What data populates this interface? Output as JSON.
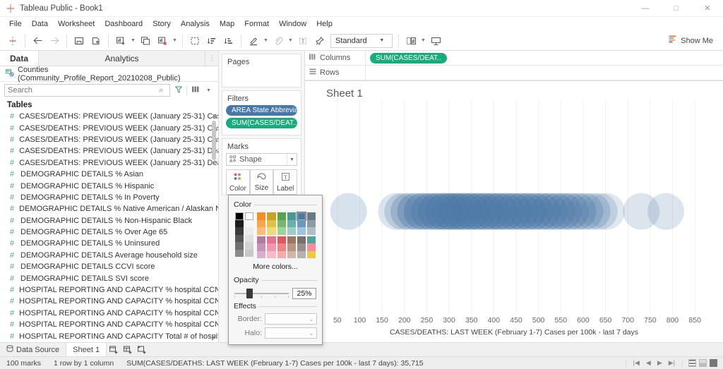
{
  "window": {
    "title": "Tableau Public - Book1",
    "logo_icon": "tableau-logo-icon",
    "minimize_label": "—",
    "maximize_label": "□",
    "close_label": "✕"
  },
  "menubar": {
    "items": [
      "File",
      "Data",
      "Worksheet",
      "Dashboard",
      "Story",
      "Analysis",
      "Map",
      "Format",
      "Window",
      "Help"
    ]
  },
  "toolbar": {
    "fit_value": "Standard",
    "show_me_label": "Show Me",
    "icons": [
      "tableau-home-icon",
      "back-arrow-icon",
      "forward-arrow-icon",
      "save-icon",
      "new-data-source-icon",
      "new-worksheet-icon",
      "duplicate-sheet-icon",
      "clear-sheet-icon",
      "clear-selection-icon",
      "sort-ascending-icon",
      "sort-descending-icon",
      "highlight-icon",
      "group-members-icon",
      "show-mark-labels-icon",
      "presentation-pin-icon",
      "fit-selector",
      "fix-axes-icon",
      "presentation-mode-icon"
    ]
  },
  "data_pane": {
    "tab_data": "Data",
    "tab_analytics": "Analytics",
    "datasource": "Counties (Community_Profile_Report_20210208_Public)",
    "datasource_icon": "data-source-icon",
    "search_placeholder": "Search",
    "search_value": "",
    "search_icon": "search-icon",
    "filter_icon": "funnel-icon",
    "group_icon": "grid-view-icon",
    "caret_icon": "chevron-down-icon",
    "tables_header": "Tables",
    "fields": [
      "CASES/DEATHS: PREVIOUS WEEK (January 25-31) Cases ...",
      "CASES/DEATHS: PREVIOUS WEEK (January 25-31) Cases ...",
      "CASES/DEATHS: PREVIOUS WEEK (January 25-31) Cases ...",
      "CASES/DEATHS: PREVIOUS WEEK (January 25-31) Deaths...",
      "CASES/DEATHS: PREVIOUS WEEK (January 25-31) Deaths...",
      "DEMOGRAPHIC DETAILS % Asian",
      "DEMOGRAPHIC DETAILS % Hispanic",
      "DEMOGRAPHIC DETAILS % In Poverty",
      "DEMOGRAPHIC DETAILS % Native American / Alaskan Nat...",
      "DEMOGRAPHIC DETAILS % Non-Hispanic Black",
      "DEMOGRAPHIC DETAILS % Over Age 65",
      "DEMOGRAPHIC DETAILS % Uninsured",
      "DEMOGRAPHIC DETAILS Average household size",
      "DEMOGRAPHIC DETAILS CCVI score",
      "DEMOGRAPHIC DETAILS SVI score",
      "HOSPITAL REPORTING AND CAPACITY % hospital CCNs e...",
      "HOSPITAL REPORTING AND CAPACITY % hospital CCNs r...",
      "HOSPITAL REPORTING AND CAPACITY % hospital CCNs r...",
      "HOSPITAL REPORTING AND CAPACITY % hospital CCNs r...",
      "HOSPITAL REPORTING AND CAPACITY Total # of hospital ..."
    ],
    "field_icon": "number-field-icon"
  },
  "shelf_column": {
    "pages_label": "Pages",
    "filters_label": "Filters",
    "filter_pills": [
      {
        "label": "AREA State Abbrevia..",
        "color": "#4878a8"
      },
      {
        "label": "SUM(CASES/DEAT..",
        "color": "#1aab7c"
      }
    ],
    "marks_label": "Marks",
    "marks_type": "Shape",
    "marks_type_icon": "shape-mark-icon",
    "buttons": [
      {
        "label": "Color",
        "icon": "color-palette-icon"
      },
      {
        "label": "Size",
        "icon": "size-icon"
      },
      {
        "label": "Label",
        "icon": "text-label-icon"
      }
    ]
  },
  "color_popup": {
    "color_label": "Color",
    "more_colors_label": "More colors...",
    "opacity_label": "Opacity",
    "opacity_value": "25%",
    "opacity_percent": 25,
    "effects_label": "Effects",
    "border_label": "Border:",
    "halo_label": "Halo:",
    "border_value": "",
    "halo_value": "",
    "swatch_columns": [
      [
        "#000000",
        "#1c1c1c",
        "#3a3a3a",
        "#555555",
        "#6f6f6f",
        "#8a8a8a"
      ],
      [
        "#ffffff",
        "#f4f4f4",
        "#e8e8e8",
        "#dddddd",
        "#d2d2d2",
        "#c6c6c6"
      ],
      [
        "#f28e2c",
        "#f5a64f",
        "#f8bd7d",
        "#b07aa1",
        "#c394b5",
        "#d7b0cb"
      ],
      [
        "#c8a02c",
        "#e0c14b",
        "#eedb7c",
        "#e15759",
        "#ef8384",
        "#f6abab"
      ],
      [
        "#59a14f",
        "#76b86c",
        "#9ed39a",
        "#e15759",
        "#ef8384",
        "#f6abab"
      ],
      [
        "#499894",
        "#6bb0ac",
        "#9ccfcb",
        "#9d7660",
        "#b99482",
        "#d2b5a6"
      ],
      [
        "#4e79a7",
        "#6f96bd",
        "#a0c4e0",
        "#79706e",
        "#958e8c",
        "#b6b0ae"
      ],
      [
        "#6b7b86",
        "#8c9aa4",
        "#b3bec6",
        "#4fa39a",
        "#f98b9e",
        "#edc948"
      ]
    ]
  },
  "view": {
    "columns_label": "Columns",
    "columns_icon": "columns-shelf-icon",
    "rows_label": "Rows",
    "rows_icon": "rows-shelf-icon",
    "columns_pill": "SUM(CASES/DEAT..",
    "sheet_title": "Sheet 1"
  },
  "chart_data": {
    "type": "scatter",
    "title": "Sheet 1",
    "xlabel": "CASES/DEATHS: LAST WEEK (February 1-7) Cases per 100k - last 7 days",
    "ylabel": "",
    "xticks": [
      50,
      100,
      150,
      200,
      250,
      300,
      350,
      400,
      450,
      500,
      550,
      600,
      650,
      700,
      750,
      800,
      850
    ],
    "xlim": [
      25,
      875
    ],
    "grid": true,
    "legend": null,
    "mark_shape": "circle",
    "mark_color": "#4e79a7",
    "mark_opacity": 0.25,
    "mark_count_label": "100 marks",
    "points": [
      {
        "x": 75,
        "r": 26,
        "a": 0.22
      },
      {
        "x": 182,
        "r": 26,
        "a": 0.2
      },
      {
        "x": 196,
        "r": 26,
        "a": 0.24
      },
      {
        "x": 210,
        "r": 26,
        "a": 0.3
      },
      {
        "x": 225,
        "r": 26,
        "a": 0.38
      },
      {
        "x": 240,
        "r": 26,
        "a": 0.45
      },
      {
        "x": 256,
        "r": 26,
        "a": 0.5
      },
      {
        "x": 272,
        "r": 26,
        "a": 0.55
      },
      {
        "x": 288,
        "r": 26,
        "a": 0.58
      },
      {
        "x": 303,
        "r": 26,
        "a": 0.6
      },
      {
        "x": 318,
        "r": 26,
        "a": 0.6
      },
      {
        "x": 333,
        "r": 26,
        "a": 0.58
      },
      {
        "x": 349,
        "r": 26,
        "a": 0.58
      },
      {
        "x": 364,
        "r": 26,
        "a": 0.56
      },
      {
        "x": 380,
        "r": 26,
        "a": 0.56
      },
      {
        "x": 396,
        "r": 26,
        "a": 0.54
      },
      {
        "x": 412,
        "r": 26,
        "a": 0.54
      },
      {
        "x": 428,
        "r": 26,
        "a": 0.52
      },
      {
        "x": 444,
        "r": 26,
        "a": 0.52
      },
      {
        "x": 460,
        "r": 26,
        "a": 0.5
      },
      {
        "x": 476,
        "r": 26,
        "a": 0.5
      },
      {
        "x": 492,
        "r": 26,
        "a": 0.48
      },
      {
        "x": 508,
        "r": 26,
        "a": 0.46
      },
      {
        "x": 524,
        "r": 26,
        "a": 0.44
      },
      {
        "x": 540,
        "r": 26,
        "a": 0.42
      },
      {
        "x": 556,
        "r": 26,
        "a": 0.4
      },
      {
        "x": 572,
        "r": 26,
        "a": 0.38
      },
      {
        "x": 588,
        "r": 26,
        "a": 0.34
      },
      {
        "x": 604,
        "r": 26,
        "a": 0.3
      },
      {
        "x": 620,
        "r": 26,
        "a": 0.26
      },
      {
        "x": 636,
        "r": 26,
        "a": 0.22
      },
      {
        "x": 652,
        "r": 26,
        "a": 0.18
      },
      {
        "x": 730,
        "r": 26,
        "a": 0.2
      },
      {
        "x": 785,
        "r": 26,
        "a": 0.2
      }
    ]
  },
  "bottom": {
    "data_source_label": "Data Source",
    "data_source_icon": "data-source-tab-icon",
    "sheet_tab_label": "Sheet 1",
    "new_worksheet_icon": "new-worksheet-tab-icon",
    "new_dashboard_icon": "new-dashboard-tab-icon",
    "new_story_icon": "new-story-tab-icon"
  },
  "status": {
    "marks": "100 marks",
    "dimensions": "1 row by 1 column",
    "aggregate": "SUM(CASES/DEATHS: LAST WEEK (February 1-7) Cases per 100k - last 7 days): 35,715",
    "nav_first_icon": "nav-first-icon",
    "nav_prev_icon": "nav-prev-icon",
    "nav_next_icon": "nav-next-icon",
    "nav_last_icon": "nav-last-icon"
  }
}
